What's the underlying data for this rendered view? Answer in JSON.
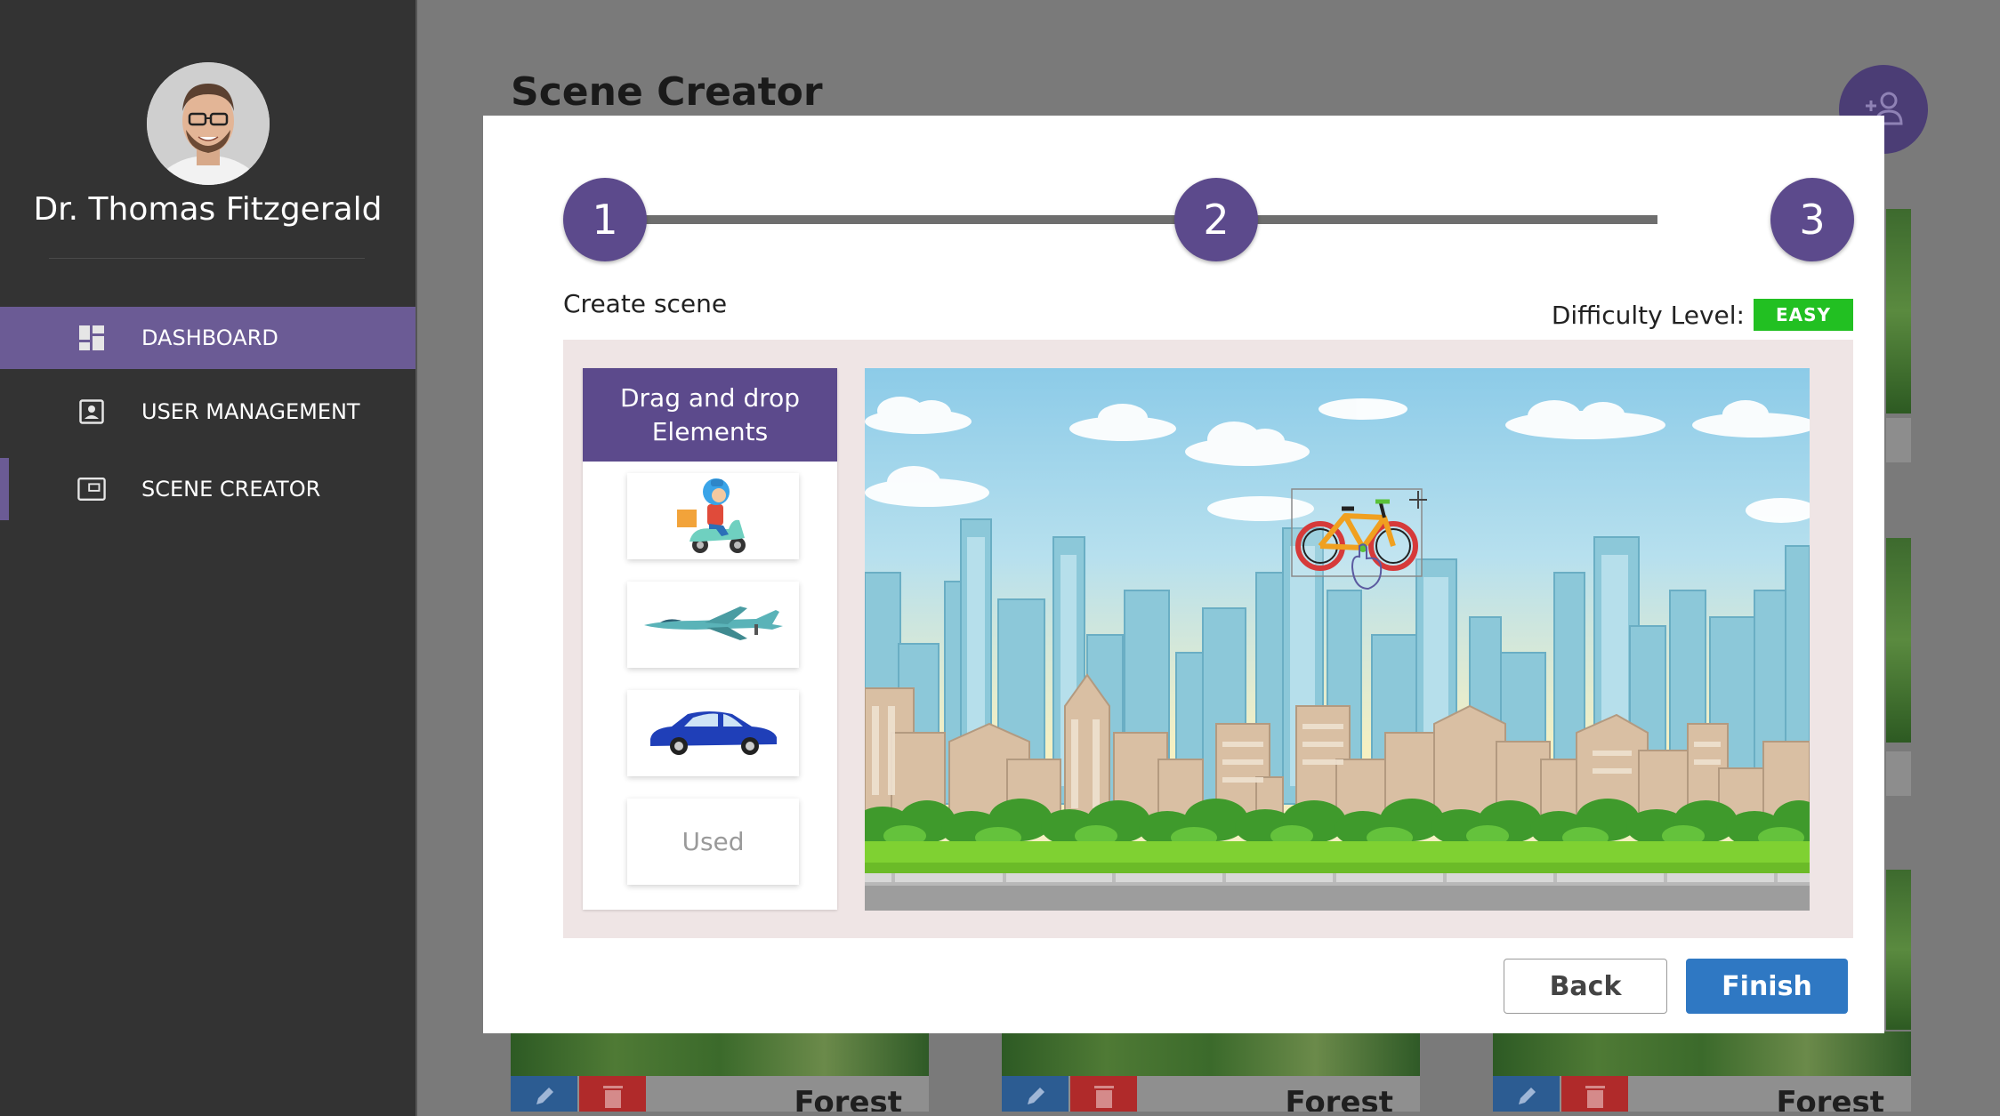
{
  "user": {
    "name": "Dr. Thomas Fitzgerald"
  },
  "nav": {
    "items": [
      {
        "label": "DASHBOARD",
        "icon": "dashboard-icon"
      },
      {
        "label": "USER MANAGEMENT",
        "icon": "user-card-icon"
      },
      {
        "label": "SCENE CREATOR",
        "icon": "scene-icon"
      }
    ],
    "active_index": 0
  },
  "page": {
    "title": "Scene Creator"
  },
  "background_cards": [
    {
      "name": "Forest"
    },
    {
      "name": "Forest"
    },
    {
      "name": "Forest"
    }
  ],
  "modal": {
    "steps": [
      "1",
      "2",
      "3"
    ],
    "section_title": "Create scene",
    "difficulty": {
      "label": "Difficulty Level:",
      "value": "EASY",
      "color": "#22c022"
    },
    "palette": {
      "header": "Drag and drop Elements",
      "tiles": [
        {
          "element": "scooter-rider",
          "used": false
        },
        {
          "element": "jet-plane",
          "used": false
        },
        {
          "element": "car",
          "used": false
        },
        {
          "element": "bicycle",
          "used": true,
          "label": "Used"
        }
      ]
    },
    "scene": {
      "background": "city-skyline",
      "placed_elements": [
        "bicycle"
      ]
    },
    "buttons": {
      "back": "Back",
      "finish": "Finish"
    }
  },
  "colors": {
    "sidebar_bg": "#333333",
    "accent_purple": "#5c4a8c",
    "finish_blue": "#2f78c3"
  }
}
